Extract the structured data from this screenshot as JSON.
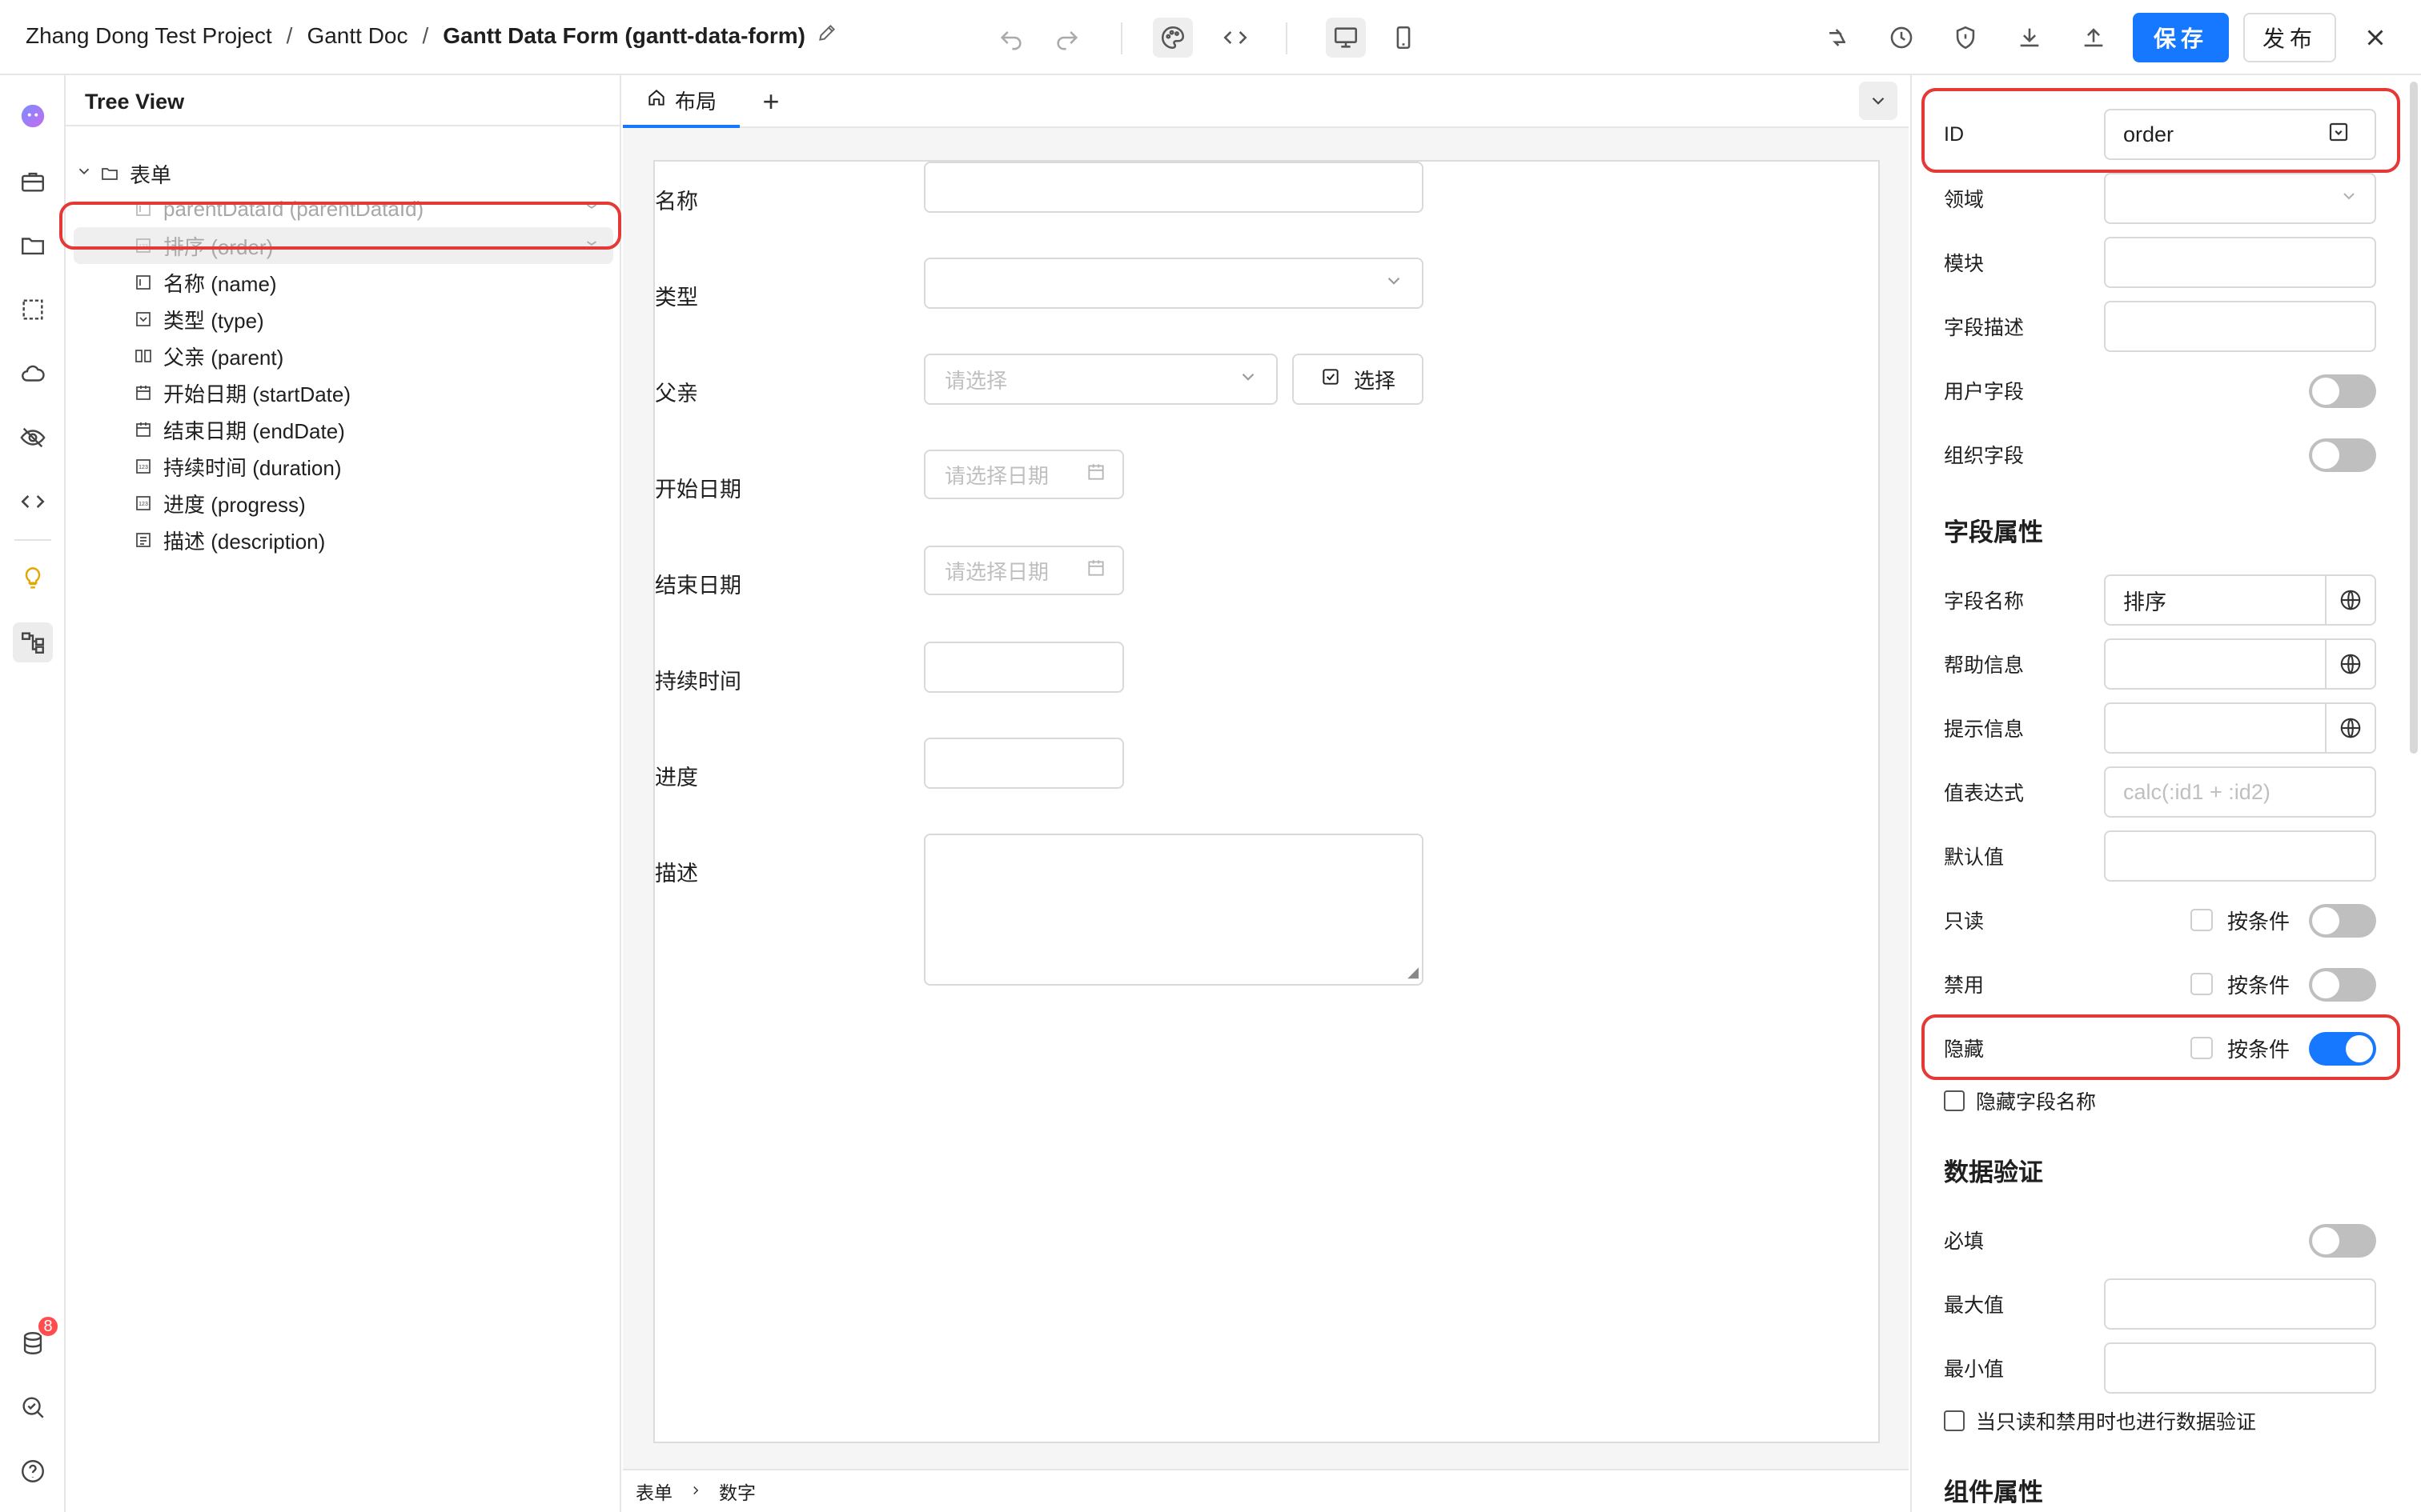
{
  "header": {
    "breadcrumb": [
      "Zhang Dong Test Project",
      "Gantt Doc",
      "Gantt Data Form (gantt-data-form)"
    ],
    "separator": "/",
    "save_label": "保存",
    "publish_label": "发布"
  },
  "rail": {
    "notification_count": "8"
  },
  "tree": {
    "title": "Tree View",
    "root": "表单",
    "items": [
      {
        "label": "parentDataId (parentDataId)",
        "icon": "input-field-icon",
        "hidden": true
      },
      {
        "label": "排序 (order)",
        "icon": "number-field-icon",
        "hidden": true,
        "selected": true
      },
      {
        "label": "名称 (name)",
        "icon": "input-field-icon",
        "hidden": false
      },
      {
        "label": "类型 (type)",
        "icon": "select-field-icon",
        "hidden": false
      },
      {
        "label": "父亲 (parent)",
        "icon": "relation-field-icon",
        "hidden": false
      },
      {
        "label": "开始日期 (startDate)",
        "icon": "date-field-icon",
        "hidden": false
      },
      {
        "label": "结束日期 (endDate)",
        "icon": "date-field-icon",
        "hidden": false
      },
      {
        "label": "持续时间 (duration)",
        "icon": "number-field-icon",
        "hidden": false
      },
      {
        "label": "进度 (progress)",
        "icon": "number-field-icon",
        "hidden": false
      },
      {
        "label": "描述 (description)",
        "icon": "textarea-field-icon",
        "hidden": false
      }
    ]
  },
  "canvas": {
    "tab_label": "布局",
    "form_fields": [
      {
        "label": "名称",
        "type": "input",
        "placeholder": ""
      },
      {
        "label": "类型",
        "type": "select",
        "placeholder": ""
      },
      {
        "label": "父亲",
        "type": "relation",
        "placeholder": "请选择",
        "button": "选择"
      },
      {
        "label": "开始日期",
        "type": "date",
        "placeholder": "请选择日期"
      },
      {
        "label": "结束日期",
        "type": "date",
        "placeholder": "请选择日期"
      },
      {
        "label": "持续时间",
        "type": "number",
        "placeholder": ""
      },
      {
        "label": "进度",
        "type": "number",
        "placeholder": ""
      },
      {
        "label": "描述",
        "type": "textarea",
        "placeholder": ""
      }
    ],
    "status_path": [
      "表单",
      "数字"
    ]
  },
  "props": {
    "id_label": "ID",
    "id_value": "order",
    "domain_label": "领域",
    "module_label": "模块",
    "field_desc_label": "字段描述",
    "user_field_label": "用户字段",
    "org_field_label": "组织字段",
    "field_props_title": "字段属性",
    "field_name_label": "字段名称",
    "field_name_value": "排序",
    "help_label": "帮助信息",
    "hint_label": "提示信息",
    "value_expr_label": "值表达式",
    "value_expr_placeholder": "calc(:id1 + :id2)",
    "default_label": "默认值",
    "readonly_label": "只读",
    "disabled_label": "禁用",
    "hidden_label": "隐藏",
    "conditional_label": "按条件",
    "hide_field_name_label": "隐藏字段名称",
    "validation_title": "数据验证",
    "required_label": "必填",
    "max_label": "最大值",
    "min_label": "最小值",
    "validate_when_ro_label": "当只读和禁用时也进行数据验证",
    "component_props_title": "组件属性",
    "toggles": {
      "user_field": false,
      "org_field": false,
      "readonly": false,
      "disabled": false,
      "hidden": true,
      "required": false
    }
  },
  "colors": {
    "accent": "#1677ff",
    "highlight": "#e53935"
  }
}
